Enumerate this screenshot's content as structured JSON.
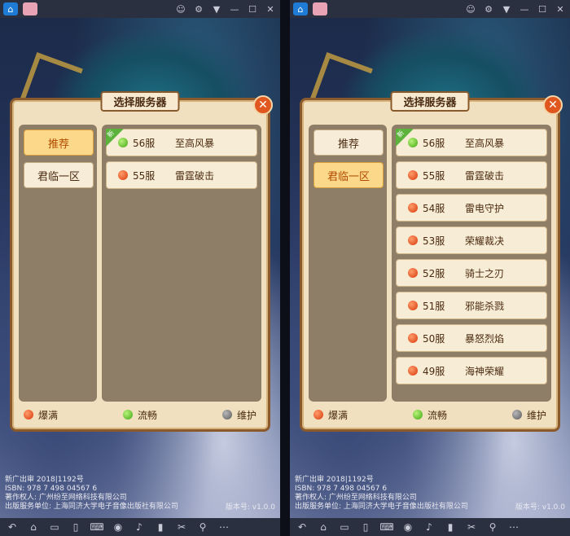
{
  "screens": [
    {
      "dialog_title": "选择服务器",
      "groups": [
        {
          "label": "推荐",
          "active": true
        },
        {
          "label": "君临一区",
          "active": false
        }
      ],
      "servers": [
        {
          "num": "56服",
          "name": "至高风暴",
          "status": "green",
          "new": true,
          "new_label": "新"
        },
        {
          "num": "55服",
          "name": "雷霆破击",
          "status": "red",
          "new": false
        }
      ]
    },
    {
      "dialog_title": "选择服务器",
      "groups": [
        {
          "label": "推荐",
          "active": false
        },
        {
          "label": "君临一区",
          "active": true
        }
      ],
      "servers": [
        {
          "num": "56服",
          "name": "至高风暴",
          "status": "green",
          "new": true,
          "new_label": "新"
        },
        {
          "num": "55服",
          "name": "雷霆破击",
          "status": "red",
          "new": false
        },
        {
          "num": "54服",
          "name": "雷电守护",
          "status": "red",
          "new": false
        },
        {
          "num": "53服",
          "name": "荣耀裁决",
          "status": "red",
          "new": false
        },
        {
          "num": "52服",
          "name": "骑士之刃",
          "status": "red",
          "new": false
        },
        {
          "num": "51服",
          "name": "邪能杀戮",
          "status": "red",
          "new": false
        },
        {
          "num": "50服",
          "name": "暴怒烈焰",
          "status": "red",
          "new": false
        },
        {
          "num": "49服",
          "name": "海神荣耀",
          "status": "red",
          "new": false
        }
      ]
    }
  ],
  "legend": {
    "full": "爆满",
    "smooth": "流畅",
    "maintenance": "维护"
  },
  "footer": {
    "line1": "新广出审 2018|1192号",
    "line2": "ISBN: 978 7 498 04567 6",
    "line3": "著作权人: 广州纷至网络科技有限公司",
    "line4": "出版服务单位: 上海同济大学电子音像出版社有限公司",
    "version": "版本号: v1.0.0"
  },
  "colors": {
    "status_red": "#d93a0b",
    "status_green": "#41a712",
    "status_gray": "#5a5a5a",
    "active_group": "#fbd88a"
  }
}
